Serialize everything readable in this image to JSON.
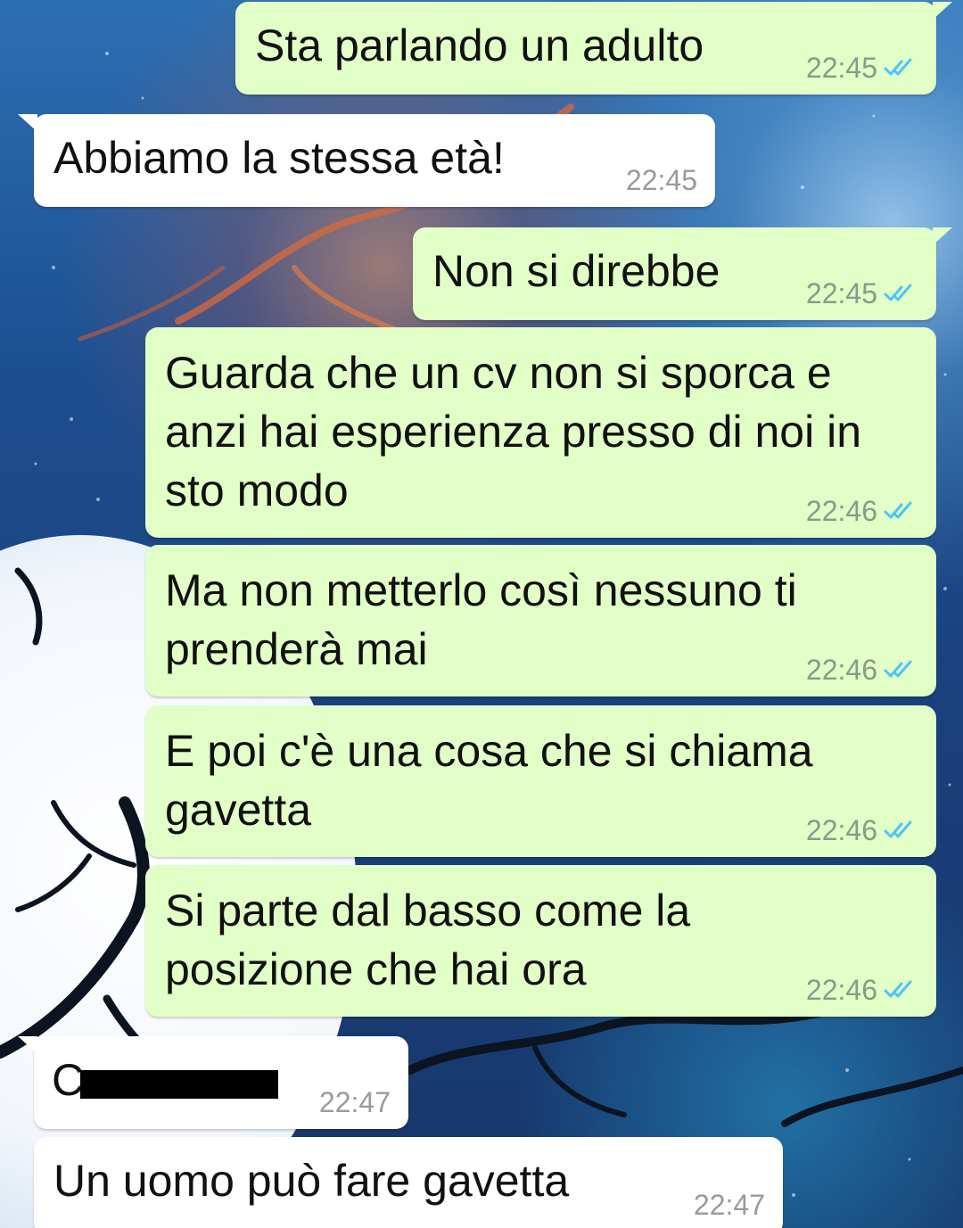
{
  "colors": {
    "outgoing_bubble": "#e1ffc7",
    "incoming_bubble": "#ffffff",
    "read_ticks": "#4fc3f7",
    "timestamp": "#8a9a86"
  },
  "icons": {
    "read_receipt": "double-check-icon"
  },
  "messages": [
    {
      "direction": "outgoing",
      "text": "Sta parlando un adulto",
      "time": "22:45",
      "status": "read"
    },
    {
      "direction": "incoming",
      "text": "Abbiamo la stessa età!",
      "time": "22:45"
    },
    {
      "direction": "outgoing",
      "text": "Non si direbbe",
      "time": "22:45",
      "status": "read"
    },
    {
      "direction": "outgoing",
      "text": "Guarda che un cv non si sporca e\nanzi hai esperienza presso di noi in\nsto modo",
      "time": "22:46",
      "status": "read"
    },
    {
      "direction": "outgoing",
      "text": "Ma non metterlo così nessuno ti\nprenderà mai",
      "time": "22:46",
      "status": "read"
    },
    {
      "direction": "outgoing",
      "text": "E poi c'è una cosa che si chiama\ngavetta",
      "time": "22:46",
      "status": "read"
    },
    {
      "direction": "outgoing",
      "text": "Si parte dal basso come la\nposizione che hai ora",
      "time": "22:46",
      "status": "read"
    },
    {
      "direction": "incoming",
      "text": "C",
      "time": "22:47",
      "redacted": true
    },
    {
      "direction": "incoming",
      "text": "Un uomo può fare gavetta",
      "time": "22:47"
    }
  ]
}
